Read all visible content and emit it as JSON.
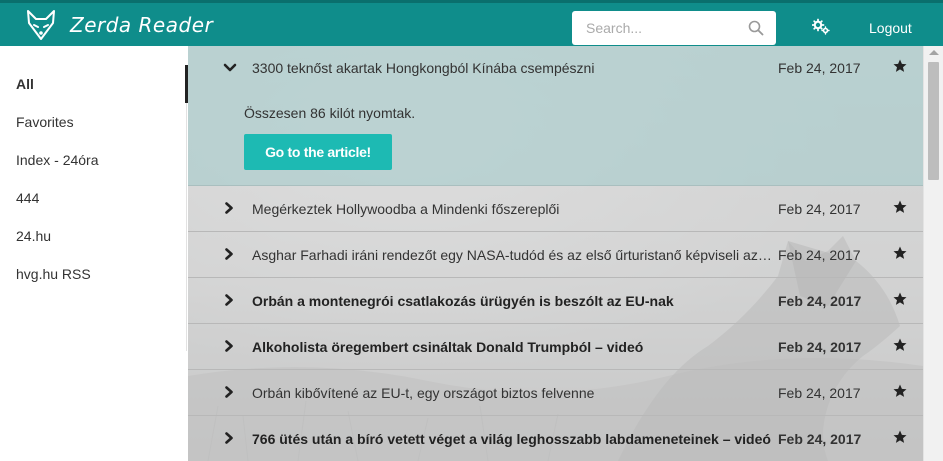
{
  "app": {
    "name": "Zerda Reader"
  },
  "search": {
    "placeholder": "Search..."
  },
  "nav": {
    "logout_label": "Logout"
  },
  "sidebar": {
    "items": [
      {
        "label": "All",
        "active": true
      },
      {
        "label": "Favorites"
      },
      {
        "label": "Index - 24óra"
      },
      {
        "label": "444"
      },
      {
        "label": "24.hu"
      },
      {
        "label": "hvg.hu RSS"
      }
    ]
  },
  "articles": {
    "expanded": {
      "title": "3300 teknőst akartak Hongkongból Kínába csempészni",
      "date": "Feb 24, 2017",
      "summary": "Összesen 86 kilót nyomtak.",
      "button_label": "Go to the article!"
    },
    "items": [
      {
        "title": "Megérkeztek Hollywoodba a Mindenki főszereplői",
        "date": "Feb 24, 2017",
        "unread": false
      },
      {
        "title": "Asghar Farhadi iráni rendezőt egy NASA-tudód és az első űrturistanő képviseli az Oscaron",
        "date": "Feb 24, 2017",
        "unread": false
      },
      {
        "title": "Orbán a montenegrói csatlakozás ürügyén is beszólt az EU-nak",
        "date": "Feb 24, 2017",
        "unread": true
      },
      {
        "title": "Alkoholista öregembert csináltak Donald Trumpból – videó",
        "date": "Feb 24, 2017",
        "unread": true
      },
      {
        "title": "Orbán kibővítené az EU-t, egy országot biztos felvenne",
        "date": "Feb 24, 2017",
        "unread": false
      },
      {
        "title": "766 ütés után a bíró vetett véget a világ leghosszabb labdameneteinek – videó",
        "date": "Feb 24, 2017",
        "unread": true
      }
    ]
  },
  "colors": {
    "topbar": "#0f8d8b",
    "accent": "#1dbab3"
  },
  "icons": {
    "logo": "fox-logo-icon",
    "search": "search-icon",
    "settings": "gears-icon",
    "expand": "chevron-right-icon",
    "collapse": "chevron-down-icon",
    "favorite": "star-icon"
  }
}
